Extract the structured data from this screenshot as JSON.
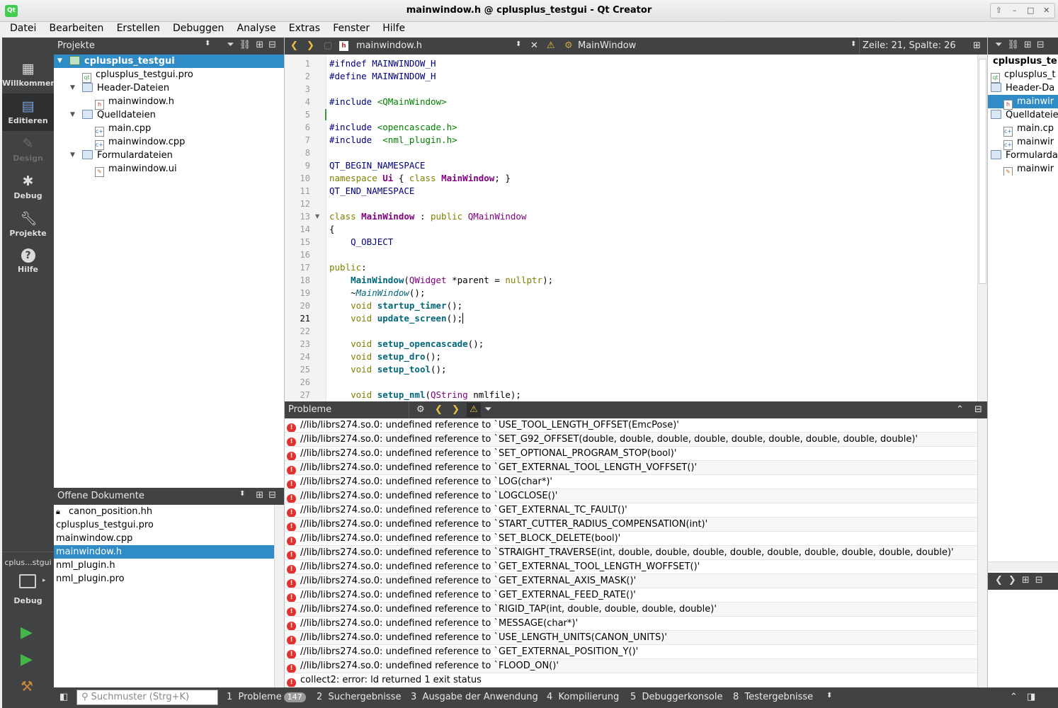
{
  "window": {
    "title": "mainwindow.h @ cplusplus_testgui - Qt Creator",
    "app_icon": "Qt"
  },
  "menu": [
    "Datei",
    "Bearbeiten",
    "Erstellen",
    "Debuggen",
    "Analyse",
    "Extras",
    "Fenster",
    "Hilfe"
  ],
  "modes": [
    {
      "label": "Willkommen",
      "icon": "grid-icon"
    },
    {
      "label": "Editieren",
      "icon": "edit-icon"
    },
    {
      "label": "Design",
      "icon": "pencil-icon"
    },
    {
      "label": "Debug",
      "icon": "bug-icon"
    },
    {
      "label": "Projekte",
      "icon": "wrench-icon"
    },
    {
      "label": "Hilfe",
      "icon": "help-icon"
    }
  ],
  "target": {
    "project": "cplus...stgui",
    "mode": "Debug"
  },
  "projects": {
    "header": "Projekte",
    "tree": [
      {
        "label": "cplusplus_testgui",
        "level": 0,
        "selected": true
      },
      {
        "label": "cplusplus_testgui.pro",
        "level": 1
      },
      {
        "label": "Header-Dateien",
        "level": 1
      },
      {
        "label": "mainwindow.h",
        "level": 2
      },
      {
        "label": "Quelldateien",
        "level": 1
      },
      {
        "label": "main.cpp",
        "level": 2
      },
      {
        "label": "mainwindow.cpp",
        "level": 2
      },
      {
        "label": "Formulardateien",
        "level": 1
      },
      {
        "label": "mainwindow.ui",
        "level": 2
      }
    ]
  },
  "open_docs": {
    "header": "Offene Dokumente",
    "items": [
      "canon_position.hh",
      "cplusplus_testgui.pro",
      "mainwindow.cpp",
      "mainwindow.h",
      "nml_plugin.h",
      "nml_plugin.pro"
    ]
  },
  "editor": {
    "file": "mainwindow.h",
    "symbol": "MainWindow",
    "position": "Zeile: 21, Spalte: 26",
    "current_line": 21,
    "lines": [
      "1",
      "2",
      "3",
      "4",
      "5",
      "6",
      "7",
      "8",
      "9",
      "10",
      "11",
      "12",
      "13",
      "14",
      "15",
      "16",
      "17",
      "18",
      "19",
      "20",
      "21",
      "22",
      "23",
      "24",
      "25",
      "26",
      "27"
    ]
  },
  "code": {
    "l1": "#ifndef MAINWINDOW_H",
    "l2": "#define MAINWINDOW_H",
    "l4a": "#include ",
    "l4b": "<QMainWindow>",
    "l6a": "#include ",
    "l6b": "<opencascade.h>",
    "l7a": "#include  ",
    "l7b": "<nml_plugin.h>",
    "l9": "QT_BEGIN_NAMESPACE",
    "l10a": "namespace ",
    "l10b": "Ui",
    " l10c": " { ",
    "l10d": "class ",
    "l10e": "MainWindow",
    "l10f": "; }",
    "l11": "QT_END_NAMESPACE",
    "l13a": "class ",
    "l13b": "MainWindow",
    "l13c": " : ",
    "l13d": "public ",
    "l13e": "QMainWindow",
    "l14": "{",
    "l15": "    Q_OBJECT",
    "l17a": "public",
    ":": ":",
    "l18a": "    ",
    "l18b": "MainWindow",
    "l18c": "(",
    "l18d": "QWidget",
    " l18e": " *parent = ",
    "l18f": "nullptr",
    "l18g": ");",
    "l19a": "    ~",
    "l19b": "MainWindow",
    "l19c": "();",
    "l20a": "    void ",
    "l20b": "startup_timer",
    "l20c": "();",
    "l21a": "    void ",
    "l21b": "update_screen",
    "l21c": "();",
    "l23a": "    void ",
    "l23b": "setup_opencascade",
    "l23c": "();",
    "l24a": "    void ",
    "l24b": "setup_dro",
    "l24c": "();",
    "l25a": "    void ",
    "l25b": "setup_tool",
    "l25c": "();",
    "l27a": "    void ",
    "l27b": "setup_nml",
    "l27c": "(",
    "l27d": "QString",
    " l27e": " nmlfile);"
  },
  "problems": {
    "header": "Probleme",
    "items": [
      "//lib/librs274.so.0: undefined reference to `USE_TOOL_LENGTH_OFFSET(EmcPose)'",
      "//lib/librs274.so.0: undefined reference to `SET_G92_OFFSET(double, double, double, double, double, double, double, double, double)'",
      "//lib/librs274.so.0: undefined reference to `SET_OPTIONAL_PROGRAM_STOP(bool)'",
      "//lib/librs274.so.0: undefined reference to `GET_EXTERNAL_TOOL_LENGTH_VOFFSET()'",
      "//lib/librs274.so.0: undefined reference to `LOG(char*)'",
      "//lib/librs274.so.0: undefined reference to `LOGCLOSE()'",
      "//lib/librs274.so.0: undefined reference to `GET_EXTERNAL_TC_FAULT()'",
      "//lib/librs274.so.0: undefined reference to `START_CUTTER_RADIUS_COMPENSATION(int)'",
      "//lib/librs274.so.0: undefined reference to `SET_BLOCK_DELETE(bool)'",
      "//lib/librs274.so.0: undefined reference to `STRAIGHT_TRAVERSE(int, double, double, double, double, double, double, double, double, double)'",
      "//lib/librs274.so.0: undefined reference to `GET_EXTERNAL_TOOL_LENGTH_WOFFSET()'",
      "//lib/librs274.so.0: undefined reference to `GET_EXTERNAL_AXIS_MASK()'",
      "//lib/librs274.so.0: undefined reference to `GET_EXTERNAL_FEED_RATE()'",
      "//lib/librs274.so.0: undefined reference to `RIGID_TAP(int, double, double, double, double)'",
      "//lib/librs274.so.0: undefined reference to `MESSAGE(char*)'",
      "//lib/librs274.so.0: undefined reference to `USE_LENGTH_UNITS(CANON_UNITS)'",
      "//lib/librs274.so.0: undefined reference to `GET_EXTERNAL_POSITION_Y()'",
      "//lib/librs274.so.0: undefined reference to `FLOOD_ON()'",
      "collect2: error: ld returned 1 exit status"
    ]
  },
  "outline": [
    "cplusplus_te",
    "cplusplus_t",
    "Header-Da",
    "mainwir",
    "Quelldateie",
    "main.cp",
    "mainwir",
    "Formularda",
    "mainwir"
  ],
  "statusbar": {
    "search_placeholder": "Suchmuster (Strg+K)",
    "tabs": [
      {
        "num": "1",
        "label": "Probleme",
        "badge": "147"
      },
      {
        "num": "2",
        "label": "Suchergebnisse"
      },
      {
        "num": "3",
        "label": "Ausgabe der Anwendung"
      },
      {
        "num": "4",
        "label": "Kompilierung"
      },
      {
        "num": "5",
        "label": "Debuggerkonsole"
      },
      {
        "num": "8",
        "label": "Testergebnisse"
      }
    ]
  }
}
